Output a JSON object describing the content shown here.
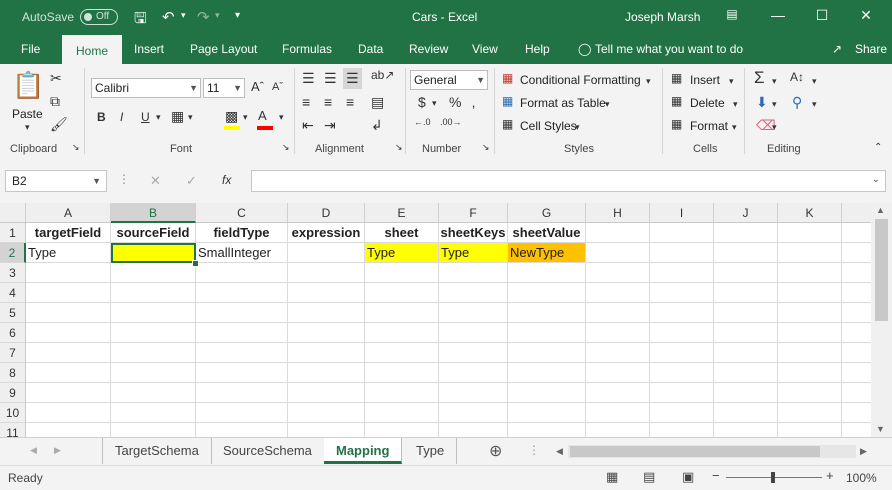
{
  "titlebar": {
    "autosave_label": "AutoSave",
    "autosave_state": "Off",
    "doc_title": "Cars  -  Excel",
    "user_name": "Joseph Marsh"
  },
  "tabs": [
    "File",
    "Home",
    "Insert",
    "Page Layout",
    "Formulas",
    "Data",
    "Review",
    "View",
    "Help"
  ],
  "active_tab": "Home",
  "tell_me": "Tell me what you want to do",
  "share": "Share",
  "ribbon": {
    "clipboard": {
      "paste": "Paste",
      "label": "Clipboard"
    },
    "font": {
      "name": "Calibri",
      "size": "11",
      "label": "Font"
    },
    "alignment": {
      "label": "Alignment"
    },
    "number": {
      "format": "General",
      "label": "Number"
    },
    "styles": {
      "conditional": "Conditional Formatting",
      "format_table": "Format as Table",
      "cell_styles": "Cell Styles",
      "label": "Styles"
    },
    "cells": {
      "insert": "Insert",
      "delete": "Delete",
      "format": "Format",
      "label": "Cells"
    },
    "editing": {
      "label": "Editing"
    }
  },
  "formula_bar": {
    "name_box": "B2",
    "fx": "fx",
    "value": ""
  },
  "columns": [
    "A",
    "B",
    "C",
    "D",
    "E",
    "F",
    "G",
    "H",
    "I",
    "J",
    "K"
  ],
  "rows": [
    "1",
    "2",
    "3",
    "4",
    "5",
    "6",
    "7",
    "8",
    "9",
    "10",
    "11"
  ],
  "cells": {
    "row1": [
      "targetField",
      "sourceField",
      "fieldType",
      "expression",
      "sheet",
      "sheetKeys",
      "sheetValue"
    ],
    "row2": [
      "Type",
      "",
      "SmallInteger",
      "",
      "Type",
      "Type",
      "NewType"
    ]
  },
  "sheets": [
    "TargetSchema",
    "SourceSchema",
    "Mapping",
    "Type"
  ],
  "active_sheet": "Mapping",
  "status": {
    "ready": "Ready",
    "zoom": "100%"
  }
}
